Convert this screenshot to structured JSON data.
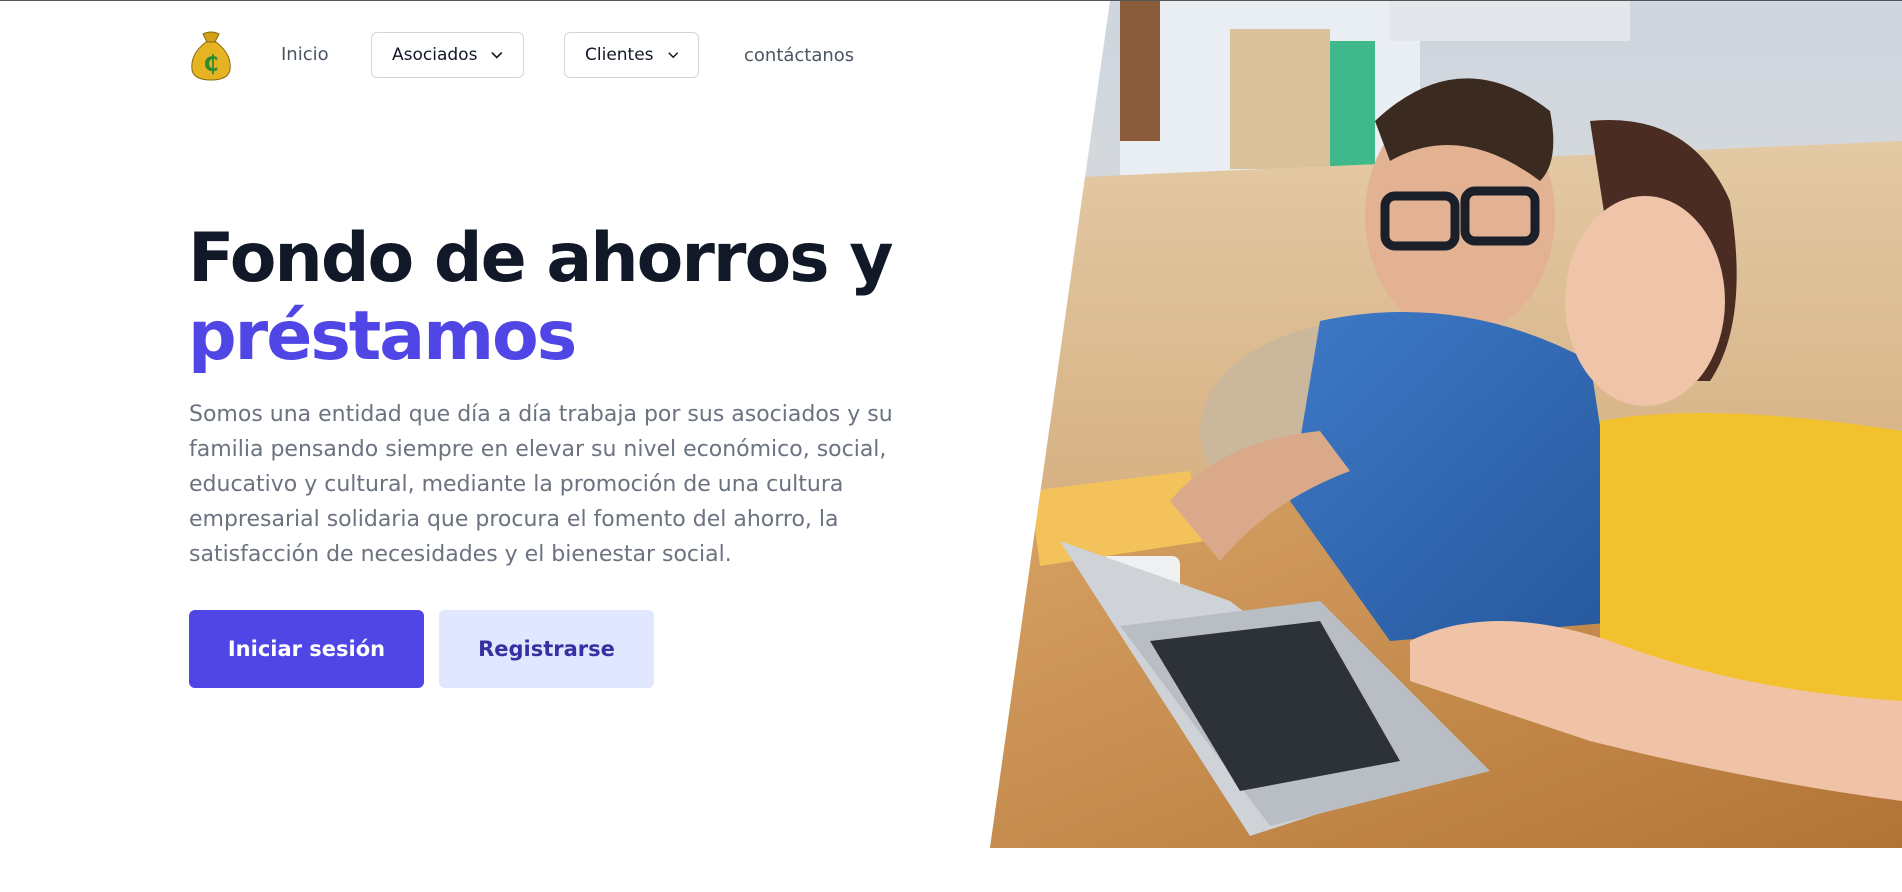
{
  "nav": {
    "logo_icon": "money-bag-icon",
    "inicio": "Inicio",
    "asociados": "Asociados",
    "clientes": "Clientes",
    "contacto": "contáctanos"
  },
  "hero": {
    "title_line1": "Fondo de ahorros y",
    "title_line2": "préstamos",
    "description": "Somos una entidad que día a día trabaja por sus asociados y su familia pensando siempre en elevar su nivel económico, social, educativo y cultural, mediante la promoción de una cultura empresarial solidaria que procura el fomento del ahorro, la satisfacción de necesidades y el bienestar social.",
    "login_label": "Iniciar sesión",
    "register_label": "Registrarse"
  },
  "colors": {
    "accent": "#4f46e5",
    "accent_light": "#e0e7ff",
    "heading": "#111827",
    "body_text": "#6b7280"
  }
}
